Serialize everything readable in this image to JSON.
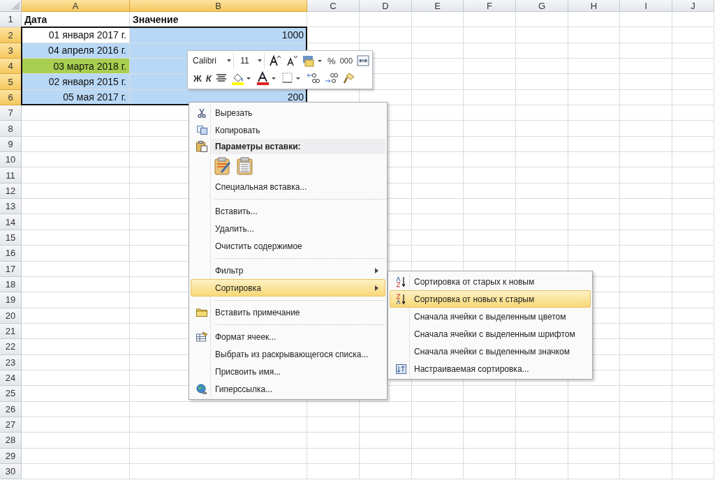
{
  "sheet": {
    "columns": [
      {
        "label": "A",
        "selected": true
      },
      {
        "label": "B",
        "selected": true
      },
      {
        "label": "C",
        "selected": false
      },
      {
        "label": "D",
        "selected": false
      },
      {
        "label": "E",
        "selected": false
      },
      {
        "label": "F",
        "selected": false
      },
      {
        "label": "G",
        "selected": false
      },
      {
        "label": "H",
        "selected": false
      },
      {
        "label": "I",
        "selected": false
      },
      {
        "label": "J",
        "selected": false
      }
    ],
    "rows": [
      {
        "label": "1",
        "selected": false,
        "cells": [
          {
            "text": "Дата",
            "kind": "header"
          },
          {
            "text": "Значение",
            "kind": "header"
          }
        ]
      },
      {
        "label": "2",
        "selected": true,
        "cells": [
          {
            "text": "01 января 2017 г.",
            "kind": "value",
            "active": true
          },
          {
            "text": "1000",
            "kind": "value",
            "active": false
          }
        ]
      },
      {
        "label": "3",
        "selected": true,
        "cells": [
          {
            "text": "04 апреля 2016 г.",
            "kind": "value",
            "active": false
          },
          {
            "kind": "value",
            "active": false
          }
        ]
      },
      {
        "label": "4",
        "selected": true,
        "cells": [
          {
            "text": "03 марта 2018 г.",
            "kind": "value",
            "active": false,
            "color": "#a8cf4f"
          },
          {
            "kind": "value",
            "active": false
          }
        ]
      },
      {
        "label": "5",
        "selected": true,
        "cells": [
          {
            "text": "02 января 2015 г.",
            "kind": "value",
            "active": false
          },
          {
            "kind": "value",
            "active": false
          }
        ]
      },
      {
        "label": "6",
        "selected": true,
        "cells": [
          {
            "text": "05 мая 2017 г.",
            "kind": "value",
            "active": false
          },
          {
            "text": "200",
            "kind": "value",
            "active": false
          }
        ]
      },
      {
        "label": "7",
        "selected": false
      },
      {
        "label": "8",
        "selected": false
      },
      {
        "label": "9",
        "selected": false
      },
      {
        "label": "10",
        "selected": false
      },
      {
        "label": "11",
        "selected": false
      },
      {
        "label": "12",
        "selected": false
      },
      {
        "label": "13",
        "selected": false
      },
      {
        "label": "14",
        "selected": false
      },
      {
        "label": "15",
        "selected": false
      },
      {
        "label": "16",
        "selected": false
      },
      {
        "label": "17",
        "selected": false
      },
      {
        "label": "18",
        "selected": false
      },
      {
        "label": "19",
        "selected": false
      },
      {
        "label": "20",
        "selected": false
      },
      {
        "label": "21",
        "selected": false
      },
      {
        "label": "22",
        "selected": false
      },
      {
        "label": "23",
        "selected": false
      },
      {
        "label": "24",
        "selected": false
      },
      {
        "label": "25",
        "selected": false
      },
      {
        "label": "26",
        "selected": false
      },
      {
        "label": "27",
        "selected": false
      },
      {
        "label": "28",
        "selected": false
      },
      {
        "label": "29",
        "selected": false
      },
      {
        "label": "30",
        "selected": false
      }
    ]
  },
  "mini_toolbar": {
    "font": "Calibri",
    "size": "11",
    "percent": "%",
    "thousands": "000",
    "bold": "Ж",
    "italic": "К"
  },
  "context_menu": {
    "items": [
      {
        "kind": "item",
        "label": "Вырезать",
        "selected": false
      },
      {
        "kind": "item",
        "label": "Копировать",
        "selected": false
      },
      {
        "kind": "header",
        "label": "Параметры вставки:"
      },
      {
        "kind": "paste_options"
      },
      {
        "kind": "item",
        "label": "Специальная вставка...",
        "selected": false
      },
      {
        "kind": "separator"
      },
      {
        "kind": "item",
        "label": "Вставить...",
        "selected": false
      },
      {
        "kind": "item",
        "label": "Удалить...",
        "selected": false
      },
      {
        "kind": "item",
        "label": "Очистить содержимое",
        "selected": false
      },
      {
        "kind": "separator"
      },
      {
        "kind": "submenu",
        "label": "Фильтр",
        "selected": false
      },
      {
        "kind": "submenu",
        "label": "Сортировка",
        "selected": true
      },
      {
        "kind": "separator"
      },
      {
        "kind": "item",
        "label": "Вставить примечание",
        "selected": false
      },
      {
        "kind": "separator"
      },
      {
        "kind": "item",
        "label": "Формат ячеек...",
        "selected": false
      },
      {
        "kind": "item",
        "label": "Выбрать из раскрывающегося списка...",
        "selected": false
      },
      {
        "kind": "item",
        "label": "Присвоить имя...",
        "selected": false
      },
      {
        "kind": "item",
        "label": "Гиперссылка...",
        "selected": false
      }
    ]
  },
  "sort_submenu": {
    "items": [
      {
        "label": "Сортировка от старых к новым",
        "selected": false
      },
      {
        "label": "Сортировка от новых к старым",
        "selected": true
      },
      {
        "label": "Сначала ячейки с выделенным цветом",
        "selected": false
      },
      {
        "label": "Сначала ячейки с выделенным шрифтом",
        "selected": false
      },
      {
        "label": "Сначала ячейки с выделенным значком",
        "selected": false
      },
      {
        "label": "Настраиваемая сортировка...",
        "selected": false
      }
    ]
  }
}
